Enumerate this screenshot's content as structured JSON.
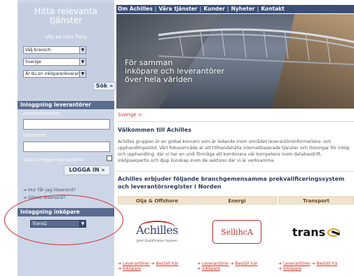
{
  "sidebar": {
    "search": {
      "title": "Hitta relevanta tjänster",
      "subtitle": "Välj en eller flera",
      "branch_select": "Välj bransch",
      "country_select": "Sverige",
      "role_select": "Är du en inköpare/leverantör",
      "search_button": "Sök »"
    },
    "supplier_login": {
      "header": "Inloggning leverantörer",
      "username_label": "Användarnamn",
      "password_label": "Lösenord",
      "remember_label": "Spara inloggningsuppgifter",
      "login_button": "LOGGA IN »",
      "how_password_link": "Hur får jag lösenord?",
      "forgot_password_link": "Glömt lösenord?"
    },
    "buyer_login": {
      "header": "Inloggning inköpare",
      "system_select": "TransQ"
    }
  },
  "nav": {
    "items": [
      "Om Achilles",
      "Våra tjänster",
      "Kunder",
      "Nyheter",
      "Kontakt"
    ],
    "separator": "|"
  },
  "hero": {
    "tagline_line1": "För samman",
    "tagline_line2": "inköpare och leverantörer",
    "tagline_line3": "över hela världen"
  },
  "main": {
    "breadcrumb": "Sverige >",
    "welcome_title": "Välkommen till Achilles",
    "intro_text": "Achilles gruppen är en global koncern som är ledande inom området leverantörsinformations- och upphandlingsstöd. Vårt fokusområde är att tillhandahålla internetbaserade tjänster och lösningar för inköp och upphandling, där vi har en unik förmåga att kombinera vår kompetens inom databasdrift, inköpsexpertis och djup kunskap inom de sektorer där vi är verksamma.",
    "offer_title": "Achilles erbjuder följande branchgemensamma prekvalificeringssystem och leverantörsregister i Norden"
  },
  "branches": [
    {
      "name": "Olja & Offshore",
      "logo": "Achilles",
      "logo_tagline": "Joint Qualification System",
      "link1": "Leverantörer",
      "link2": "Beställ här",
      "link3": "Inköpare"
    },
    {
      "name": "Energi",
      "logo": "SellihcA",
      "link1": "Leverantörer",
      "link2": "Beställ här",
      "link3": "Inköpare"
    },
    {
      "name": "Transport",
      "logo": "trans",
      "link1": "Leverantörer",
      "link2": "Beställ hä",
      "link3": "Inköpare"
    }
  ],
  "colors": {
    "sidebar_bg": "#cdd6e6",
    "section_header_bg": "#5a6c8f",
    "nav_bg": "#3a4e78",
    "accent_red": "#d4352a",
    "annotation_red": "#d4222a"
  },
  "icons": {
    "link_arrow": "arrow-right-icon",
    "select_arrow": "chevron-down-icon"
  }
}
